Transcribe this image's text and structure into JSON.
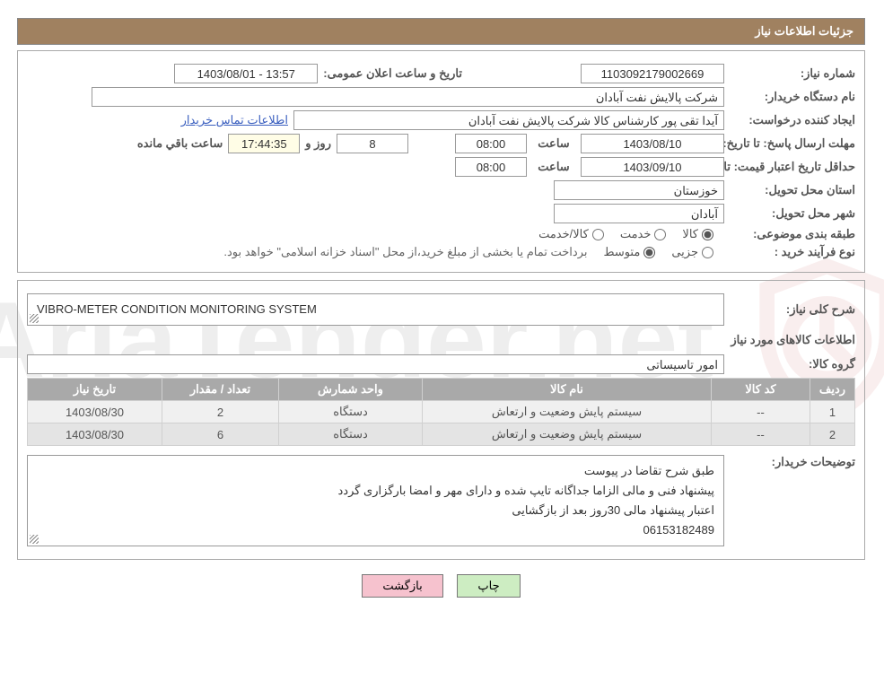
{
  "header": {
    "title": "جزئیات اطلاعات نیاز"
  },
  "sec1": {
    "need_no_label": "شماره نیاز:",
    "need_no": "1103092179002669",
    "announce_label": "تاریخ و ساعت اعلان عمومی:",
    "announce": "1403/08/01 - 13:57",
    "buyer_org_label": "نام دستگاه خریدار:",
    "buyer_org": "شرکت پالایش نفت آبادان",
    "requester_label": "ایجاد کننده درخواست:",
    "requester": "آیدا تقی پور کارشناس کالا شرکت پالایش نفت آبادان",
    "contact_link": "اطلاعات تماس خریدار",
    "deadline_label": "مهلت ارسال پاسخ:",
    "until": "تا تاریخ:",
    "deadline_date": "1403/08/10",
    "time_label": "ساعت",
    "deadline_time": "08:00",
    "days_label": "روز و",
    "days_remaining": "8",
    "countdown": "17:44:35",
    "remaining_label": "ساعت باقي مانده",
    "validity_label": "حداقل تاریخ اعتبار قیمت:",
    "validity_date": "1403/09/10",
    "validity_time": "08:00",
    "province_label": "استان محل تحویل:",
    "province": "خوزستان",
    "city_label": "شهر محل تحویل:",
    "city": "آبادان",
    "class_label": "طبقه بندی موضوعی:",
    "class_opts": {
      "goods": "کالا",
      "service": "خدمت",
      "both": "کالا/خدمت"
    },
    "process_label": "نوع فرآیند خرید :",
    "process_opts": {
      "minor": "جزیی",
      "medium": "متوسط"
    },
    "process_note": "برداخت تمام یا بخشی از مبلغ خرید،از محل \"اسناد خزانه اسلامی\" خواهد بود."
  },
  "sec2": {
    "overview_label": "شرح کلی نیاز:",
    "overview": "VIBRO-METER CONDITION MONITORING SYSTEM",
    "items_title": "اطلاعات کالاهای مورد نیاز",
    "group_label": "گروه کالا:",
    "group": "امور تاسیساتی",
    "columns": {
      "row": "ردیف",
      "code": "کد کالا",
      "name": "نام کالا",
      "unit": "واحد شمارش",
      "qty": "تعداد / مقدار",
      "date": "تاریخ نیاز"
    },
    "items": [
      {
        "row": "1",
        "code": "--",
        "name": "سیستم پایش وضعیت و ارتعاش",
        "unit": "دستگاه",
        "qty": "2",
        "date": "1403/08/30"
      },
      {
        "row": "2",
        "code": "--",
        "name": "سیستم پایش وضعیت و ارتعاش",
        "unit": "دستگاه",
        "qty": "6",
        "date": "1403/08/30"
      }
    ],
    "buyer_notes_label": "توضیحات خریدار:",
    "buyer_notes": [
      "طبق شرح تقاضا در پیوست",
      "پیشنهاد فنی و مالی الزاما جداگانه تایپ شده و دارای مهر و امضا بارگزاری گردد",
      "اعتبار پیشنهاد مالی 30روز بعد از بازگشایی",
      "06153182489"
    ]
  },
  "buttons": {
    "print": "چاپ",
    "back": "بازگشت"
  },
  "watermark": "AriaTender.net"
}
